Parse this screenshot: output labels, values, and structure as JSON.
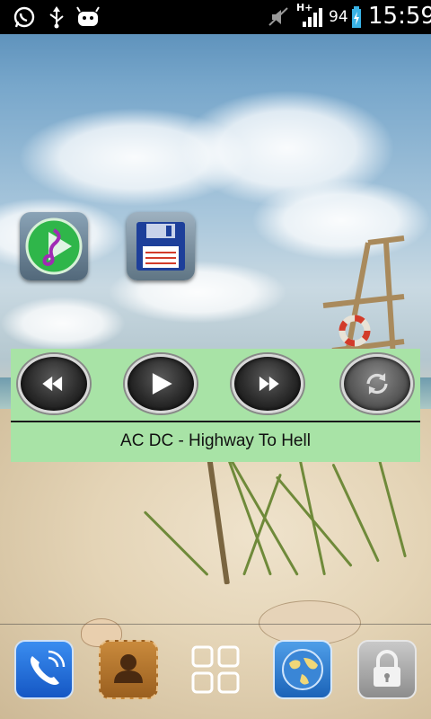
{
  "status_bar": {
    "battery_level": "94",
    "time": "15:59",
    "network_type": "H+",
    "icons": [
      "whatsapp-icon",
      "usb-icon",
      "android-icon",
      "mute-icon",
      "signal-icon",
      "battery-icon"
    ]
  },
  "home_icons": [
    "music-player-app-icon",
    "floppy-save-app-icon"
  ],
  "player_widget": {
    "track": "AC DC - Highway To Hell",
    "controls": [
      "rewind",
      "play",
      "fast-forward",
      "repeat"
    ]
  },
  "dock": {
    "icons": [
      "phone-icon",
      "contacts-icon",
      "app-drawer-icon",
      "browser-globe-icon",
      "lock-icon"
    ]
  },
  "colors": {
    "widget_bg": "#a8e3a6",
    "status_bar_bg": "#000000",
    "phone_blue": "#1e6fd9",
    "contacts_brown": "#b8742a"
  }
}
